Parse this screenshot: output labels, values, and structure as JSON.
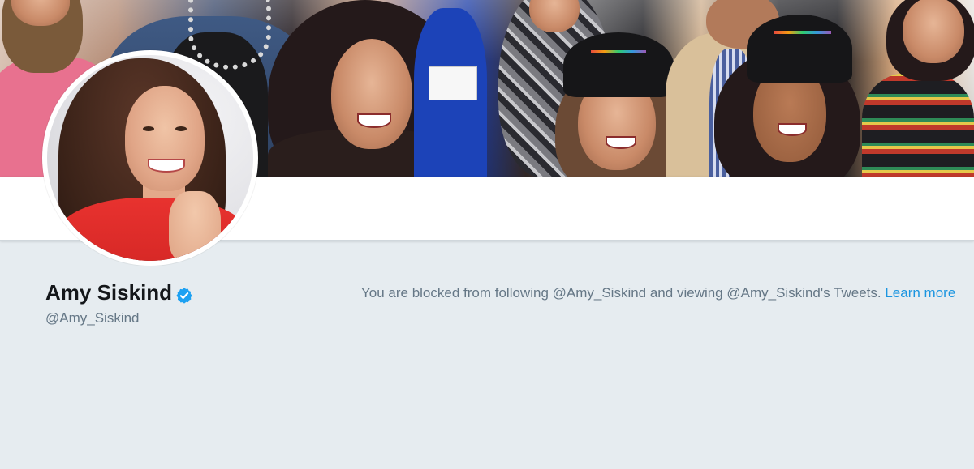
{
  "profile": {
    "name": "Amy Siskind",
    "handle": "@Amy_Siskind",
    "verified": true
  },
  "blocked_message": {
    "text": "You are blocked from following @Amy_Siskind and viewing @Amy_Siskind's Tweets.",
    "link_label": "Learn more"
  },
  "icons": {
    "verified_badge": "verified-badge-icon"
  },
  "colors": {
    "page_background": "#e6ecf0",
    "link": "#1b95e0",
    "verified": "#1da1f2",
    "name_text": "#14171a",
    "secondary_text": "#657786"
  }
}
